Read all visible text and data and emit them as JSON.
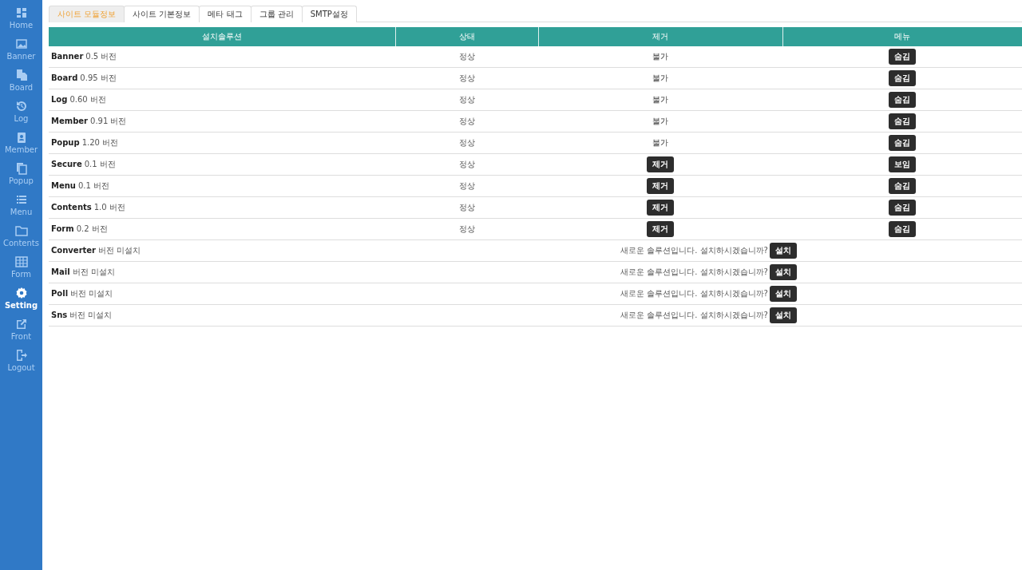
{
  "sidebar": {
    "items": [
      {
        "label": "Home",
        "selected": false
      },
      {
        "label": "Banner",
        "selected": false
      },
      {
        "label": "Board",
        "selected": false
      },
      {
        "label": "Log",
        "selected": false
      },
      {
        "label": "Member",
        "selected": false
      },
      {
        "label": "Popup",
        "selected": false
      },
      {
        "label": "Menu",
        "selected": false
      },
      {
        "label": "Contents",
        "selected": false
      },
      {
        "label": "Form",
        "selected": false
      },
      {
        "label": "Setting",
        "selected": true
      },
      {
        "label": "Front",
        "selected": false
      },
      {
        "label": "Logout",
        "selected": false
      }
    ]
  },
  "tabs": [
    {
      "label": "사이트 모듈정보",
      "selected": true
    },
    {
      "label": "사이트 기본정보",
      "selected": false
    },
    {
      "label": "메타 태그",
      "selected": false
    },
    {
      "label": "그룹 관리",
      "selected": false
    },
    {
      "label": "SMTP설정",
      "selected": false
    }
  ],
  "table": {
    "columns": [
      "설치솔루션",
      "상태",
      "제거",
      "메뉴"
    ],
    "rows": [
      {
        "kind": "installed",
        "name": "Banner",
        "version": "0.5 버전",
        "status": "정상",
        "remove": {
          "kind": "text",
          "label": "불가"
        },
        "menu": "숨김"
      },
      {
        "kind": "installed",
        "name": "Board",
        "version": "0.95 버전",
        "status": "정상",
        "remove": {
          "kind": "text",
          "label": "불가"
        },
        "menu": "숨김"
      },
      {
        "kind": "installed",
        "name": "Log",
        "version": "0.60 버전",
        "status": "정상",
        "remove": {
          "kind": "text",
          "label": "불가"
        },
        "menu": "숨김"
      },
      {
        "kind": "installed",
        "name": "Member",
        "version": "0.91 버전",
        "status": "정상",
        "remove": {
          "kind": "text",
          "label": "불가"
        },
        "menu": "숨김"
      },
      {
        "kind": "installed",
        "name": "Popup",
        "version": "1.20 버전",
        "status": "정상",
        "remove": {
          "kind": "text",
          "label": "불가"
        },
        "menu": "숨김"
      },
      {
        "kind": "installed",
        "name": "Secure",
        "version": "0.1 버전",
        "status": "정상",
        "remove": {
          "kind": "button",
          "label": "제거"
        },
        "menu": "보임"
      },
      {
        "kind": "installed",
        "name": "Menu",
        "version": "0.1 버전",
        "status": "정상",
        "remove": {
          "kind": "button",
          "label": "제거"
        },
        "menu": "숨김"
      },
      {
        "kind": "installed",
        "name": "Contents",
        "version": "1.0 버전",
        "status": "정상",
        "remove": {
          "kind": "button",
          "label": "제거"
        },
        "menu": "숨김"
      },
      {
        "kind": "installed",
        "name": "Form",
        "version": "0.2 버전",
        "status": "정상",
        "remove": {
          "kind": "button",
          "label": "제거"
        },
        "menu": "숨김"
      },
      {
        "kind": "available",
        "name": "Converter",
        "version": "버전 미설치",
        "prompt": "새로운 솔루션입니다. 설치하시겠습니까?",
        "action": "설치"
      },
      {
        "kind": "available",
        "name": "Mail",
        "version": "버전 미설치",
        "prompt": "새로운 솔루션입니다. 설치하시겠습니까?",
        "action": "설치"
      },
      {
        "kind": "available",
        "name": "Poll",
        "version": "버전 미설치",
        "prompt": "새로운 솔루션입니다. 설치하시겠습니까?",
        "action": "설치"
      },
      {
        "kind": "available",
        "name": "Sns",
        "version": "버전 미설치",
        "prompt": "새로운 솔루션입니다. 설치하시겠습니까?",
        "action": "설치"
      }
    ]
  }
}
